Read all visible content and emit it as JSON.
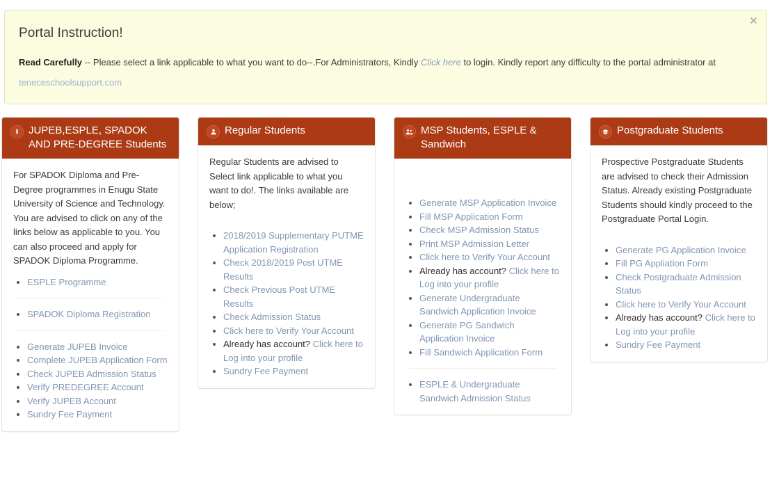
{
  "alert": {
    "close_label": "×",
    "title": "Portal Instruction!",
    "lead": "Read Carefully",
    "text_before_link": " -- Please select a link applicable to what you want to do--.For Administrators, Kindly ",
    "inline_link": "Click here",
    "text_after_link": " to login. Kindly report any difficulty to the portal administrator at ",
    "support_link": "teneceschoolsupport.com"
  },
  "panels": [
    {
      "id": "jupeb",
      "icon": "info-badge-icon",
      "title": "JUPEB,ESPLE, SPADOK AND PRE-DEGREE Students",
      "description": "For SPADOK Diploma and Pre-Degree programmes in Enugu State University of Science and Technology. You are advised to click on any of the links below as applicable to you. You can also proceed and apply for SPADOK Diploma Programme.",
      "groups": [
        {
          "items": [
            {
              "text": "ESPLE Programme",
              "type": "link"
            }
          ]
        },
        {
          "items": [
            {
              "text": "SPADOK Diploma Registration",
              "type": "link"
            }
          ]
        },
        {
          "items": [
            {
              "text": "Generate JUPEB Invoice",
              "type": "link"
            },
            {
              "text": "Complete JUPEB Application Form",
              "type": "link"
            },
            {
              "text": "Check JUPEB Admission Status",
              "type": "link"
            },
            {
              "text": "Verify PREDEGREE Account",
              "type": "link"
            },
            {
              "text": "Verify JUPEB Account",
              "type": "link"
            },
            {
              "text": "Sundry Fee Payment",
              "type": "link"
            }
          ]
        }
      ]
    },
    {
      "id": "regular",
      "icon": "students-badge-icon",
      "title": "Regular Students",
      "description": "Regular Students are advised to Select link applicable to what you want to do!. The links available are below;",
      "groups": [
        {
          "items": [
            {
              "text": "2018/2019 Supplementary PUTME Application Registration",
              "type": "link"
            },
            {
              "text": "Check 2018/2019 Post UTME Results",
              "type": "link"
            },
            {
              "text": "Check Previous Post UTME Results",
              "type": "link"
            },
            {
              "text": "Check Admission Status",
              "type": "link"
            },
            {
              "text": "Click here to Verify Your Account",
              "type": "link"
            },
            {
              "text": "Already has account? ",
              "type": "mixed",
              "link_text": "Click here to Log into your profile"
            },
            {
              "text": "Sundry Fee Payment",
              "type": "link"
            }
          ]
        }
      ]
    },
    {
      "id": "msp",
      "icon": "group-badge-icon",
      "title": "MSP Students, ESPLE & Sandwich",
      "description": "",
      "groups": [
        {
          "items": [
            {
              "text": "Generate MSP Application Invoice",
              "type": "link"
            },
            {
              "text": "Fill MSP Application Form",
              "type": "link"
            },
            {
              "text": "Check MSP Admission Status",
              "type": "link"
            },
            {
              "text": "Print MSP Admission Letter",
              "type": "link"
            },
            {
              "text": "Click here to Verify Your Account",
              "type": "link"
            },
            {
              "text": "Already has account? ",
              "type": "mixed",
              "link_text": "Click here to Log into your profile"
            },
            {
              "text": "Generate Undergraduate Sandwich Application Invoice",
              "type": "link"
            },
            {
              "text": "Generate PG Sandwich Application Invoice",
              "type": "link"
            },
            {
              "text": "Fill Sandwich Application Form",
              "type": "link"
            }
          ]
        },
        {
          "items": [
            {
              "text": "ESPLE & Undergraduate Sandwich Admission Status",
              "type": "link"
            }
          ]
        }
      ]
    },
    {
      "id": "postgraduate",
      "icon": "graduation-badge-icon",
      "title": "Postgraduate Students",
      "description": "Prospective Postgraduate Students are advised to check their Admission Status. Already existing Postgraduate Students should kindly proceed to the Postgraduate Portal Login.",
      "groups": [
        {
          "items": [
            {
              "text": "Generate PG Application Invoice",
              "type": "link"
            },
            {
              "text": "Fill PG Appliation Form",
              "type": "link"
            },
            {
              "text": "Check Postgraduate Admission Status",
              "type": "link"
            },
            {
              "text": "Click here to Verify Your Account",
              "type": "link"
            },
            {
              "text": "Already has account? ",
              "type": "mixed",
              "link_text": "Click here to Log into your profile"
            },
            {
              "text": "Sundry Fee Payment",
              "type": "link"
            }
          ]
        }
      ]
    }
  ],
  "colors": {
    "panel_header": "#ab3a15",
    "alert_bg": "#fcfce0",
    "link": "#8096b4"
  }
}
